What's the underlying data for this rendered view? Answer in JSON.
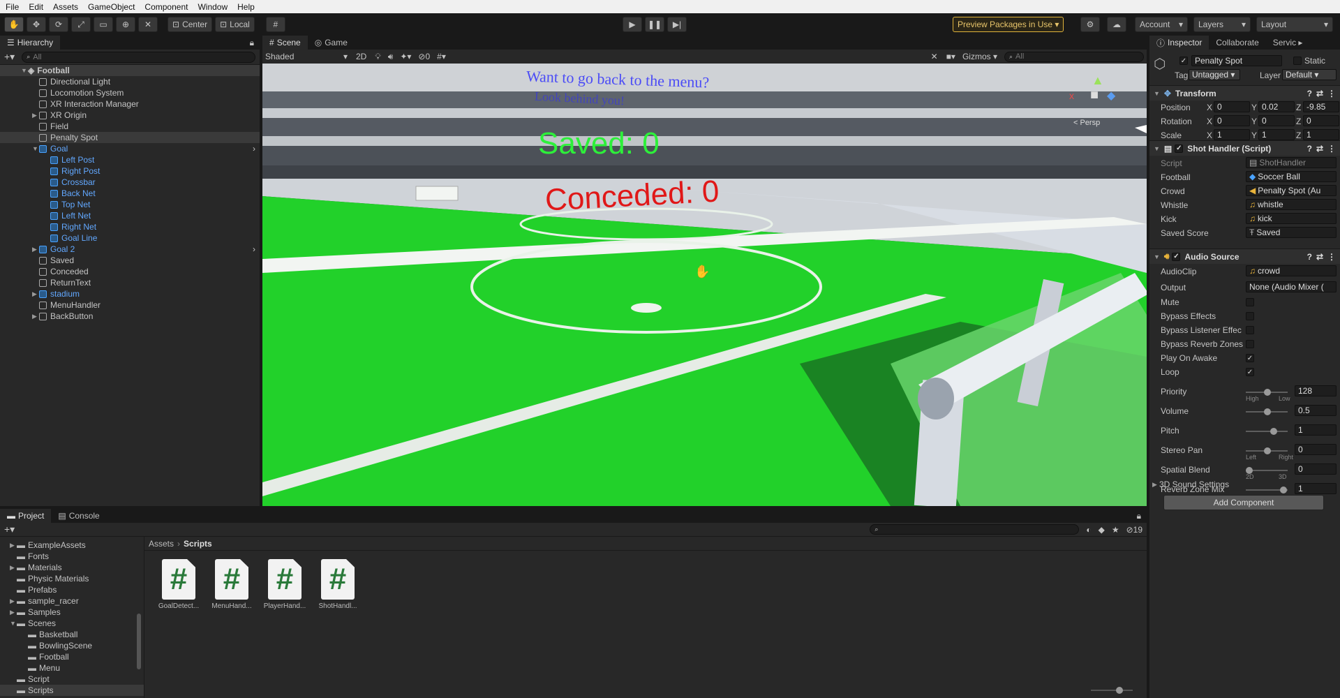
{
  "menu": [
    "File",
    "Edit",
    "Assets",
    "GameObject",
    "Component",
    "Window",
    "Help"
  ],
  "toolbar": {
    "center_label": "Center",
    "local_label": "Local",
    "preview_packages": "Preview Packages in Use",
    "account": "Account",
    "layers": "Layers",
    "layout": "Layout"
  },
  "hierarchy": {
    "tab": "Hierarchy",
    "search_placeholder": "All",
    "scene": "Football",
    "items": [
      {
        "label": "Directional Light",
        "indent": 1,
        "arrow": false,
        "blue": false
      },
      {
        "label": "Locomotion System",
        "indent": 1,
        "arrow": false,
        "blue": false
      },
      {
        "label": "XR Interaction Manager",
        "indent": 1,
        "arrow": false,
        "blue": false
      },
      {
        "label": "XR Origin",
        "indent": 1,
        "arrow": true,
        "blue": false
      },
      {
        "label": "Field",
        "indent": 1,
        "arrow": false,
        "blue": false
      },
      {
        "label": "Penalty Spot",
        "indent": 1,
        "arrow": false,
        "blue": false,
        "selected": true
      },
      {
        "label": "Goal",
        "indent": 1,
        "arrow": "open",
        "blue": true
      },
      {
        "label": "Left Post",
        "indent": 2,
        "arrow": false,
        "blue": true
      },
      {
        "label": "Right Post",
        "indent": 2,
        "arrow": false,
        "blue": true
      },
      {
        "label": "Crossbar",
        "indent": 2,
        "arrow": false,
        "blue": true
      },
      {
        "label": "Back Net",
        "indent": 2,
        "arrow": false,
        "blue": true
      },
      {
        "label": "Top Net",
        "indent": 2,
        "arrow": false,
        "blue": true
      },
      {
        "label": "Left Net",
        "indent": 2,
        "arrow": false,
        "blue": true
      },
      {
        "label": "Right Net",
        "indent": 2,
        "arrow": false,
        "blue": true
      },
      {
        "label": "Goal Line",
        "indent": 2,
        "arrow": false,
        "blue": true
      },
      {
        "label": "Goal 2",
        "indent": 1,
        "arrow": true,
        "blue": true
      },
      {
        "label": "Saved",
        "indent": 1,
        "arrow": false,
        "blue": false
      },
      {
        "label": "Conceded",
        "indent": 1,
        "arrow": false,
        "blue": false
      },
      {
        "label": "ReturnText",
        "indent": 1,
        "arrow": false,
        "blue": false
      },
      {
        "label": "stadium",
        "indent": 1,
        "arrow": true,
        "blue": true
      },
      {
        "label": "MenuHandler",
        "indent": 1,
        "arrow": false,
        "blue": false
      },
      {
        "label": "BackButton",
        "indent": 1,
        "arrow": true,
        "blue": false
      }
    ]
  },
  "scene_view": {
    "tab_scene": "Scene",
    "tab_game": "Game",
    "shading": "Shaded",
    "mode_2d": "2D",
    "hidden_count": "0",
    "gizmos": "Gizmos",
    "search_placeholder": "All",
    "persp": "< Persp",
    "text_blue_1": "Want to go back to the menu?",
    "text_blue_2": "Look behind you!",
    "saved_text": "Saved: 0",
    "conceded_text": "Conceded: 0"
  },
  "inspector": {
    "tab_inspector": "Inspector",
    "tab_collaborate": "Collaborate",
    "tab_services": "Servic",
    "object_name": "Penalty Spot",
    "static_label": "Static",
    "tag_label": "Tag",
    "tag_value": "Untagged",
    "layer_label": "Layer",
    "layer_value": "Default",
    "transform": {
      "title": "Transform",
      "position": {
        "label": "Position",
        "x": "0",
        "y": "0.02",
        "z": "-9.85"
      },
      "rotation": {
        "label": "Rotation",
        "x": "0",
        "y": "0",
        "z": "0"
      },
      "scale": {
        "label": "Scale",
        "x": "1",
        "y": "1",
        "z": "1"
      }
    },
    "shot_handler": {
      "title": "Shot Handler (Script)",
      "rows": [
        {
          "label": "Script",
          "value": "ShotHandler"
        },
        {
          "label": "Football",
          "value": "Soccer Ball"
        },
        {
          "label": "Crowd",
          "value": "Penalty Spot (Au"
        },
        {
          "label": "Whistle",
          "value": "whistle"
        },
        {
          "label": "Kick",
          "value": "kick"
        },
        {
          "label": "Saved Score",
          "value": "Saved"
        }
      ]
    },
    "audio_source": {
      "title": "Audio Source",
      "audioclip_label": "AudioClip",
      "audioclip_value": "crowd",
      "output_label": "Output",
      "output_value": "None (Audio Mixer (",
      "checks": [
        {
          "label": "Mute",
          "checked": false
        },
        {
          "label": "Bypass Effects",
          "checked": false
        },
        {
          "label": "Bypass Listener Effec",
          "checked": false
        },
        {
          "label": "Bypass Reverb Zones",
          "checked": false
        },
        {
          "label": "Play On Awake",
          "checked": true
        },
        {
          "label": "Loop",
          "checked": true
        }
      ],
      "sliders": [
        {
          "label": "Priority",
          "value": "128",
          "level": 0.5,
          "left": "High",
          "right": "Low"
        },
        {
          "label": "Volume",
          "value": "0.5",
          "level": 0.5
        },
        {
          "label": "Pitch",
          "value": "1",
          "level": 0.67
        },
        {
          "label": "Stereo Pan",
          "value": "0",
          "level": 0.5,
          "left": "Left",
          "right": "Right"
        },
        {
          "label": "Spatial Blend",
          "value": "0",
          "level": 0.0,
          "left": "2D",
          "right": "3D"
        },
        {
          "label": "Reverb Zone Mix",
          "value": "1",
          "level": 0.95
        }
      ],
      "sound_settings": "3D Sound Settings"
    },
    "add_component": "Add Component"
  },
  "project": {
    "tab_project": "Project",
    "tab_console": "Console",
    "hidden_count": "19",
    "breadcrumb_root": "Assets",
    "breadcrumb_current": "Scripts",
    "tree": [
      {
        "label": "ExampleAssets",
        "indent": 1,
        "arrow": true
      },
      {
        "label": "Fonts",
        "indent": 1,
        "arrow": false
      },
      {
        "label": "Materials",
        "indent": 1,
        "arrow": true
      },
      {
        "label": "Physic Materials",
        "indent": 1,
        "arrow": false
      },
      {
        "label": "Prefabs",
        "indent": 1,
        "arrow": false
      },
      {
        "label": "sample_racer",
        "indent": 1,
        "arrow": true
      },
      {
        "label": "Samples",
        "indent": 1,
        "arrow": true
      },
      {
        "label": "Scenes",
        "indent": 1,
        "arrow": "open"
      },
      {
        "label": "Basketball",
        "indent": 2,
        "arrow": false
      },
      {
        "label": "BowlingScene",
        "indent": 2,
        "arrow": false
      },
      {
        "label": "Football",
        "indent": 2,
        "arrow": false
      },
      {
        "label": "Menu",
        "indent": 2,
        "arrow": false
      },
      {
        "label": "Script",
        "indent": 1,
        "arrow": false
      },
      {
        "label": "Scripts",
        "indent": 1,
        "arrow": false,
        "selected": true
      }
    ],
    "files": [
      {
        "label": "GoalDetect..."
      },
      {
        "label": "MenuHand..."
      },
      {
        "label": "PlayerHand..."
      },
      {
        "label": "ShotHandl..."
      }
    ]
  }
}
